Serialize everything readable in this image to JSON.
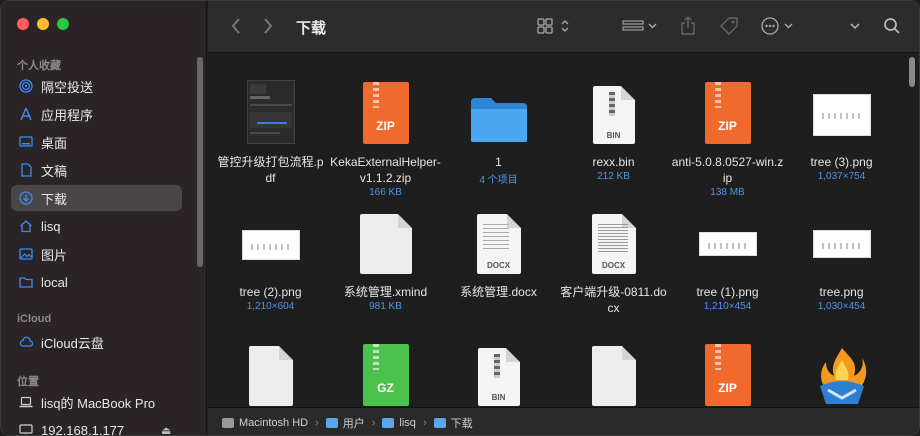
{
  "sidebar": {
    "sections": [
      {
        "header": "个人收藏",
        "items": [
          {
            "label": "隔空投送",
            "icon": "airdrop-icon"
          },
          {
            "label": "应用程序",
            "icon": "applications-icon"
          },
          {
            "label": "桌面",
            "icon": "desktop-icon"
          },
          {
            "label": "文稿",
            "icon": "document-icon"
          },
          {
            "label": "下载",
            "icon": "downloads-icon",
            "active": true
          },
          {
            "label": "lisq",
            "icon": "home-icon"
          },
          {
            "label": "图片",
            "icon": "pictures-icon"
          },
          {
            "label": "local",
            "icon": "folder-icon"
          }
        ]
      },
      {
        "header": "iCloud",
        "items": [
          {
            "label": "iCloud云盘",
            "icon": "icloud-icon"
          }
        ]
      },
      {
        "header": "位置",
        "items": [
          {
            "label": "lisq的 MacBook Pro",
            "icon": "laptop-icon"
          },
          {
            "label": "192.168.1.177",
            "icon": "monitor-icon"
          }
        ]
      }
    ]
  },
  "toolbar": {
    "title": "下载",
    "buttons": [
      "back-icon",
      "forward-icon",
      "view-grid-icon",
      "group-icon",
      "share-icon",
      "tag-icon",
      "more-icon",
      "expand-icon",
      "search-icon"
    ]
  },
  "files": [
    {
      "name": "管控升级打包流程.pdf",
      "meta": "",
      "kind": "pdf"
    },
    {
      "name": "KekaExternalHelper-v1.1.2.zip",
      "meta": "166 KB",
      "kind": "zip"
    },
    {
      "name": "1",
      "meta": "4 个项目",
      "kind": "folder"
    },
    {
      "name": "rexx.bin",
      "meta": "212 KB",
      "kind": "bin"
    },
    {
      "name": "anti-5.0.8.0527-win.zip",
      "meta": "138 MB",
      "kind": "zip"
    },
    {
      "name": "tree (3).png",
      "meta": "1,037×754",
      "kind": "png"
    },
    {
      "name": "tree (2).png",
      "meta": "1,210×604",
      "kind": "png"
    },
    {
      "name": "系统管理.xmind",
      "meta": "981 KB",
      "kind": "blank"
    },
    {
      "name": "系统管理.docx",
      "meta": "",
      "kind": "docx"
    },
    {
      "name": "客户端升级-0811.docx",
      "meta": "",
      "kind": "docx"
    },
    {
      "name": "tree (1).png",
      "meta": "1,210×454",
      "kind": "png"
    },
    {
      "name": "tree.png",
      "meta": "1,030×454",
      "kind": "png"
    },
    {
      "name": "",
      "meta": "",
      "kind": "blank"
    },
    {
      "name": "",
      "meta": "",
      "kind": "gz"
    },
    {
      "name": "",
      "meta": "",
      "kind": "bin"
    },
    {
      "name": "",
      "meta": "",
      "kind": "blank"
    },
    {
      "name": "",
      "meta": "",
      "kind": "zip"
    },
    {
      "name": "",
      "meta": "",
      "kind": "app"
    }
  ],
  "labels": {
    "zip": "ZIP",
    "gz": "GZ",
    "bin": "BIN",
    "docx": "DOCX"
  },
  "pathbar": [
    "Macintosh HD",
    "用户",
    "lisq",
    "下载"
  ],
  "colors": {
    "accent": "#3d8bf2",
    "zip": "#f06a2e",
    "gz": "#4cc24d",
    "folder": "#3a9bea"
  }
}
